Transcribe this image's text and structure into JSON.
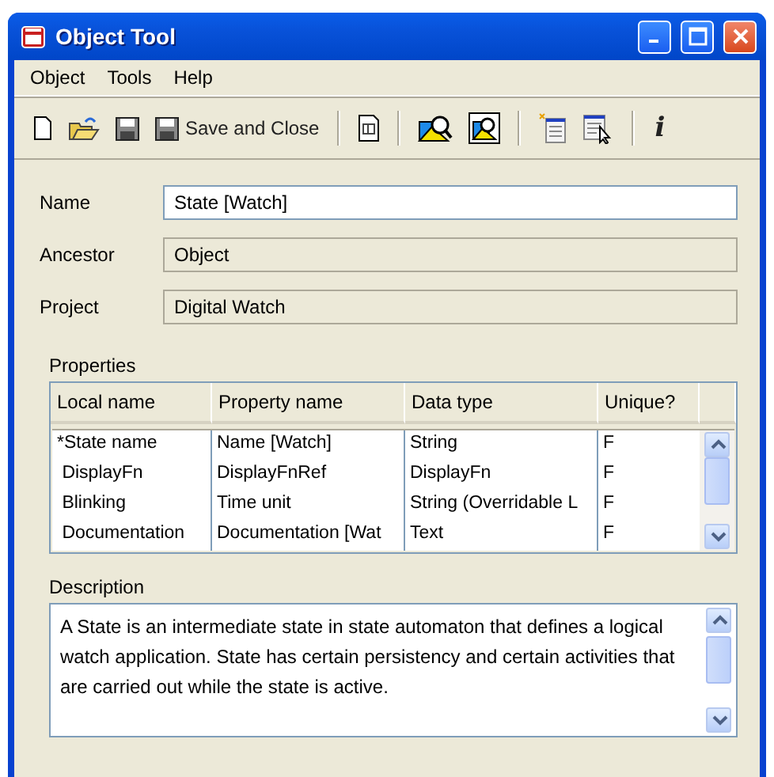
{
  "window": {
    "title": "Object Tool"
  },
  "menu": [
    "Object",
    "Tools",
    "Help"
  ],
  "toolbar": [
    {
      "kind": "new"
    },
    {
      "kind": "open"
    },
    {
      "kind": "save"
    },
    {
      "kind": "save_close",
      "label": "Save and Close"
    },
    {
      "kind": "separator"
    },
    {
      "kind": "id"
    },
    {
      "kind": "separator"
    },
    {
      "kind": "picture"
    },
    {
      "kind": "picture_framed"
    },
    {
      "kind": "separator"
    },
    {
      "kind": "list_new"
    },
    {
      "kind": "list_select"
    },
    {
      "kind": "separator"
    },
    {
      "kind": "info",
      "label": "i"
    }
  ],
  "fields": [
    {
      "label": "Name",
      "value": "State [Watch]",
      "disabled": false
    },
    {
      "label": "Ancestor",
      "value": "Object",
      "disabled": true
    },
    {
      "label": "Project",
      "value": "Digital Watch",
      "disabled": true
    }
  ],
  "properties": {
    "label": "Properties",
    "columns": [
      "Local name",
      "Property name",
      "Data type",
      "Unique?"
    ],
    "rows": [
      [
        "*State name",
        "Name [Watch]",
        "String",
        "F"
      ],
      [
        " DisplayFn",
        "DisplayFnRef",
        "DisplayFn",
        "F"
      ],
      [
        " Blinking",
        "Time unit",
        "String (Overridable L",
        "F"
      ],
      [
        " Documentation",
        "Documentation [Wat",
        "Text",
        "F"
      ]
    ]
  },
  "description": {
    "label": "Description",
    "value": "A State is an intermediate state in state automaton that defines a logical watch application. State has certain persistency and certain activities that are carried out while the state is active."
  }
}
